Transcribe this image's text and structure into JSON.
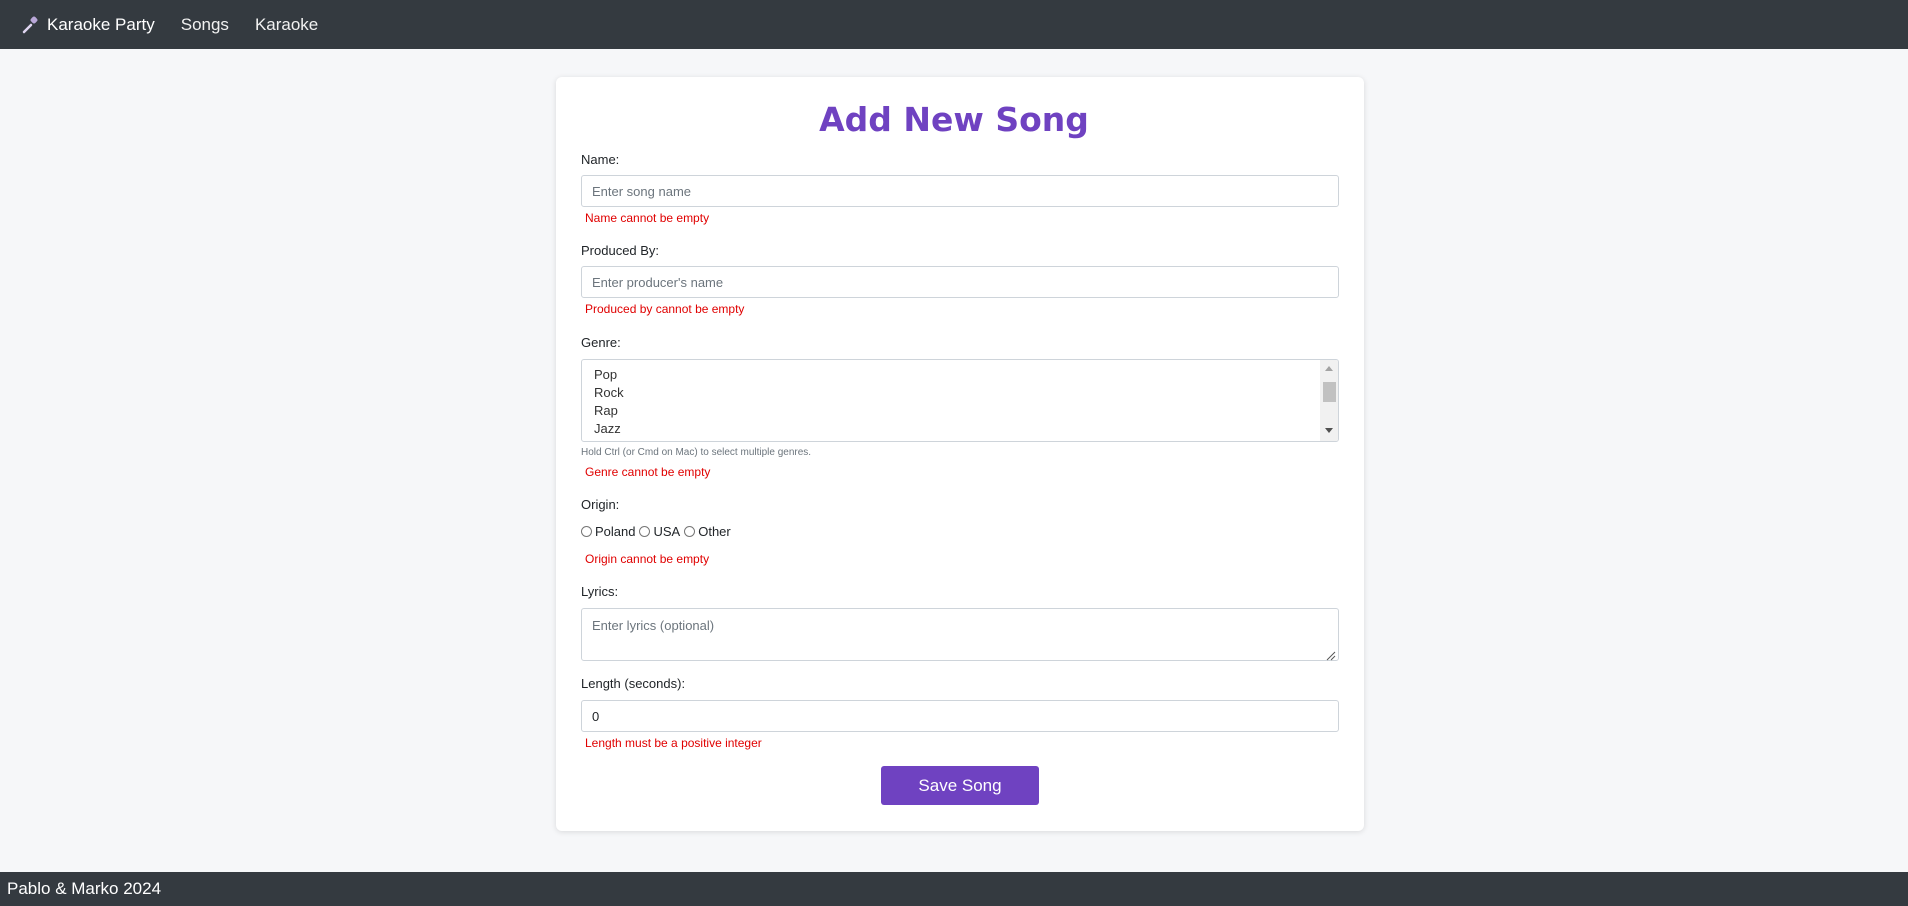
{
  "navbar": {
    "brand": "Karaoke Party",
    "brand_icon": "microphone-icon",
    "links": [
      "Songs",
      "Karaoke"
    ]
  },
  "form": {
    "title": "Add New Song",
    "name": {
      "label": "Name:",
      "placeholder": "Enter song name",
      "value": "",
      "error": "Name cannot be empty"
    },
    "produced_by": {
      "label": "Produced By:",
      "placeholder": "Enter producer's name",
      "value": "",
      "error": "Produced by cannot be empty"
    },
    "genre": {
      "label": "Genre:",
      "options": [
        "Pop",
        "Rock",
        "Rap",
        "Jazz"
      ],
      "hint": "Hold Ctrl (or Cmd on Mac) to select multiple genres.",
      "error": "Genre cannot be empty"
    },
    "origin": {
      "label": "Origin:",
      "options": [
        "Poland",
        "USA",
        "Other"
      ],
      "error": "Origin cannot be empty"
    },
    "lyrics": {
      "label": "Lyrics:",
      "placeholder": "Enter lyrics (optional)",
      "value": ""
    },
    "length": {
      "label": "Length (seconds):",
      "value": "0",
      "error": "Length must be a positive integer"
    },
    "save_label": "Save Song"
  },
  "footer": {
    "text": "Pablo & Marko 2024"
  },
  "colors": {
    "accent": "#6f42c1",
    "navbar": "#343a40",
    "error": "#e00000"
  }
}
